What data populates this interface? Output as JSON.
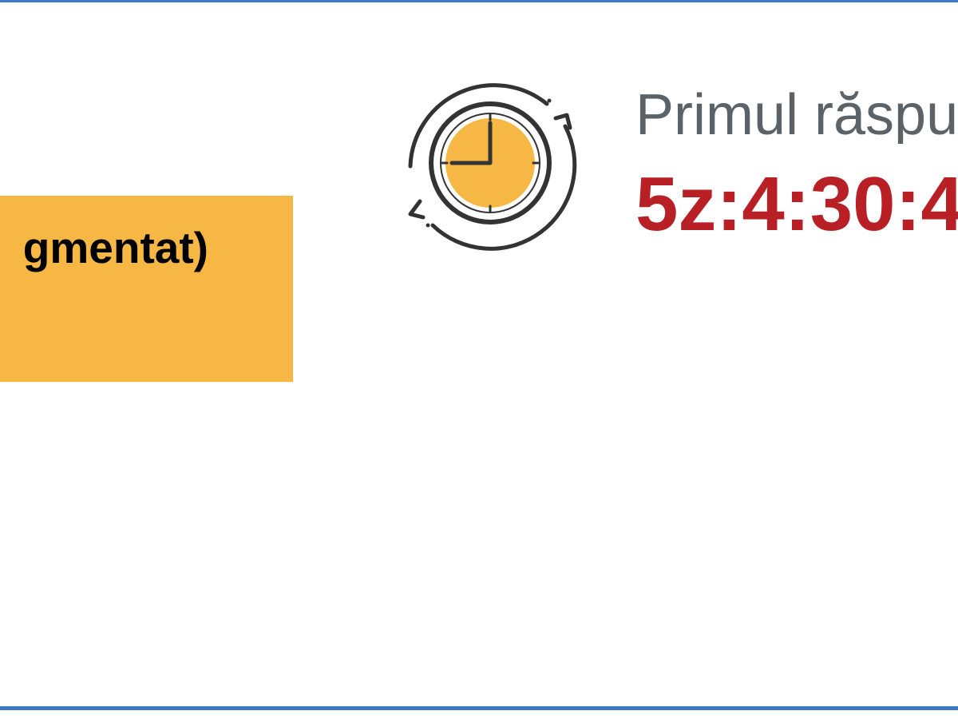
{
  "panel": {
    "badge_text": "gmentat)",
    "response_label": "Primul răspu",
    "response_value": "5z:4:30:4"
  },
  "icons": {
    "clock": "clock-refresh-icon"
  },
  "colors": {
    "border": "#3f78c7",
    "badge_background": "#f6b745",
    "badge_text": "#000000",
    "label_text": "#5b6369",
    "value_text": "#b82025",
    "clock_face": "#f6b745",
    "clock_outline": "#333333"
  }
}
